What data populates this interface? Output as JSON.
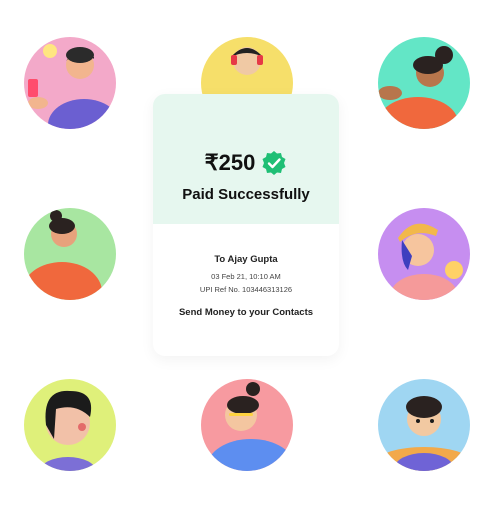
{
  "payment": {
    "amount": "₹250",
    "status": "Paid Successfully",
    "recipient": "To Ajay Gupta",
    "date": "03 Feb 21, 10:10 AM",
    "upi_ref": "UPI Ref No. 103446313126",
    "cta": "Send Money to your Contacts"
  },
  "icons": {
    "verified": "verified-check-badge-icon"
  },
  "colors": {
    "card_top": "#e6f7ef",
    "badge": "#1fbf75",
    "avatar_pink": "#f3a9c9",
    "avatar_yellow": "#f6df6a",
    "avatar_teal": "#63e6c6",
    "avatar_green": "#a8e6a1",
    "avatar_purple": "#c68ef0",
    "avatar_lime": "#dff07a",
    "avatar_coral": "#f79aa0",
    "avatar_sky": "#9fd6f2"
  }
}
